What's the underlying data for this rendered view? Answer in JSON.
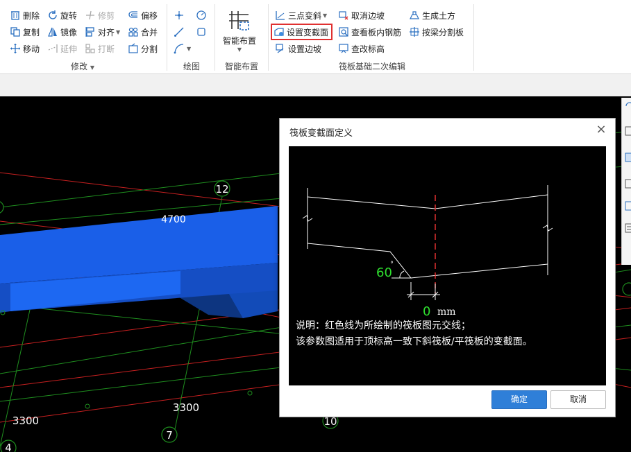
{
  "ribbon": {
    "modify": {
      "items": [
        "删除",
        "旋转",
        "修剪",
        "偏移",
        "复制",
        "镜像",
        "对齐",
        "合并",
        "移动",
        "延伸",
        "打断",
        "分割"
      ],
      "label": "修改"
    },
    "draw": {
      "label": "绘图"
    },
    "smart": {
      "button": "智能布置",
      "label": "智能布置"
    },
    "raft": {
      "items": [
        "三点变斜",
        "取消边坡",
        "生成土方",
        "设置变截面",
        "查看板内钢筋",
        "按梁分割板",
        "设置边坡",
        "查改标高"
      ],
      "label": "筏板基础二次编辑"
    }
  },
  "canvas": {
    "labels": [
      "12",
      "4700",
      "3300",
      "3300",
      "7",
      "10",
      "4"
    ]
  },
  "dialog": {
    "title": "筏板变截面定义",
    "close": "×",
    "angle_value": "60",
    "degree": "°",
    "offset_value": "0",
    "unit": "mm",
    "desc_line1": "说明：红色线为所绘制的筏板图元交线；",
    "desc_line2": "该参数图适用于顶标高一致下斜筏板/平筏板的变截面。",
    "ok": "确定",
    "cancel": "取消"
  },
  "colors": {
    "accent": "#2f7fd8",
    "highlight": "#e03030",
    "slab": "#1a5fe8",
    "grid_green": "#1f8f1f",
    "grid_red": "#c82020",
    "param_green": "#2fe02f"
  }
}
